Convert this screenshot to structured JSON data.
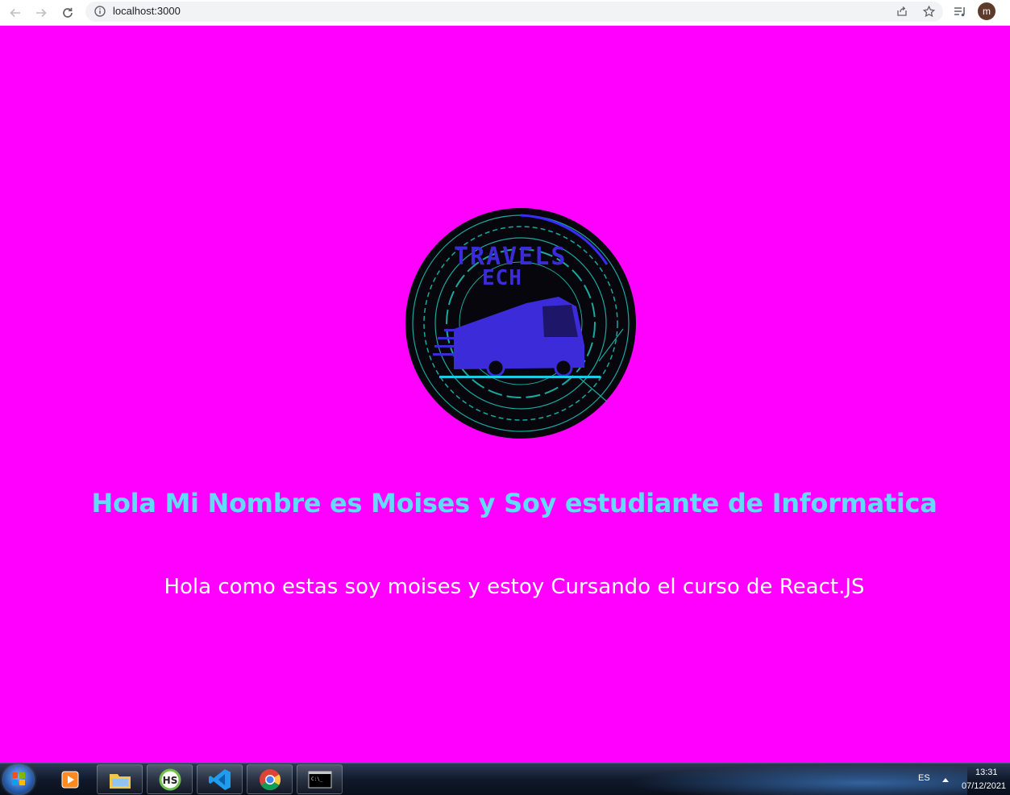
{
  "browser": {
    "url": "localhost:3000",
    "profile_initial": "m"
  },
  "page": {
    "background_color": "#ff00ff",
    "logo_alt": "Travels Tech logo",
    "logo_text_line1": "TRAVELS",
    "logo_text_line2": "ECH",
    "heading": "Hola Mi Nombre es Moises y Soy estudiante de Informatica",
    "heading_color": "#61dafb",
    "subtext": "Hola como estas soy moises y estoy Cursando el curso de React.JS"
  },
  "taskbar": {
    "language": "ES",
    "time": "13:31",
    "date": "07/12/2021",
    "apps": [
      "start-icon",
      "media-player-icon",
      "file-explorer-icon",
      "hs-app-icon",
      "vscode-icon",
      "chrome-icon",
      "cmd-icon"
    ]
  }
}
